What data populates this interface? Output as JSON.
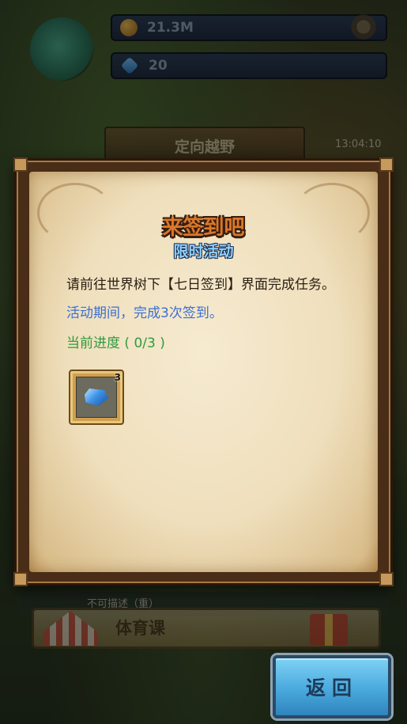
{
  "hud": {
    "gold_amount": "21.3M",
    "gem_amount": "20",
    "mode_title": "定向越野",
    "clock": "13:04:10"
  },
  "dialog": {
    "title": "来签到吧",
    "subtitle": "限时活动",
    "instruction": "请前往世界树下【七日签到】界面完成任务。",
    "requirement": "活动期间，完成3次签到。",
    "progress": "当前进度 ( 0/3 )",
    "reward": {
      "icon": "blue-crystal-icon",
      "count": "3"
    }
  },
  "background": {
    "row_text": "不可描述（重）",
    "course_label": "体育课"
  },
  "buttons": {
    "return_label": "返回"
  },
  "colors": {
    "instruction_text": "#2b2014",
    "requirement_text": "#3b6fd3",
    "progress_text": "#2e9b3e",
    "title_orange": "#d9772c",
    "subtitle_blue": "#8fd0ff",
    "button_blue": "#49a9dd"
  }
}
